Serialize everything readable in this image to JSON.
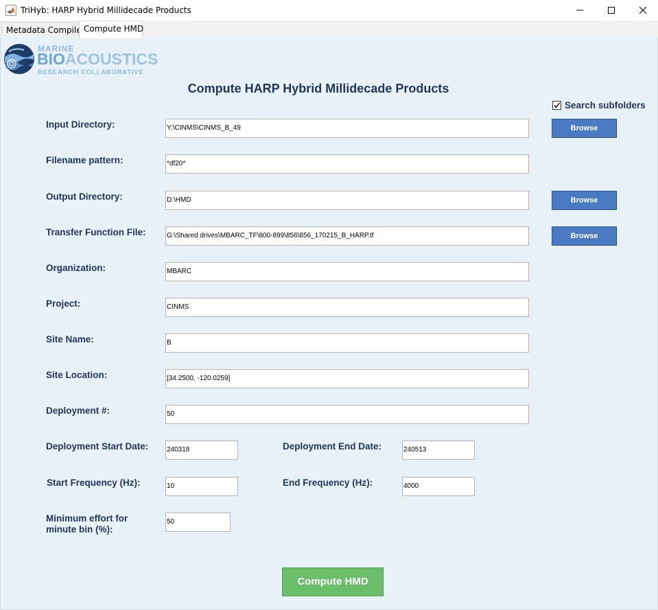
{
  "window": {
    "title": "TriHyb: HARP Hybrid Millidecade Products"
  },
  "tabs": [
    {
      "label": "Metadata Compiler",
      "active": false
    },
    {
      "label": "Compute HMD",
      "active": true
    }
  ],
  "logo": {
    "line1": "MARINE",
    "line2_bio": "BIO",
    "line2_rest": "ACOUSTICS",
    "line3": "RESEARCH COLLABORATIVE"
  },
  "heading": "Compute HARP Hybrid Millidecade Products",
  "search_subfolders": {
    "label": "Search subfolders",
    "checked": true
  },
  "browse_label": "Browse",
  "fields": {
    "input_directory": {
      "label": "Input Directory:",
      "value": "Y:\\CINMS\\CINMS_B_49"
    },
    "filename_pattern": {
      "label": "Filename pattern:",
      "value": "*df20*"
    },
    "output_directory": {
      "label": "Output Directory:",
      "value": "D:\\HMD"
    },
    "transfer_function_file": {
      "label": "Transfer Function File:",
      "value": "G:\\Shared drives\\MBARC_TF\\800-899\\856\\856_170215_B_HARP.tf"
    },
    "organization": {
      "label": "Organization:",
      "value": "MBARC"
    },
    "project": {
      "label": "Project:",
      "value": "CINMS"
    },
    "site_name": {
      "label": "Site Name:",
      "value": "B"
    },
    "site_location": {
      "label": "Site Location:",
      "value": "[34.2500, -120.0259]"
    },
    "deployment_number": {
      "label": "Deployment #:",
      "value": "50"
    },
    "deployment_start_date": {
      "label": "Deployment Start Date:",
      "value": "240318"
    },
    "deployment_end_date": {
      "label": "Deployment End Date:",
      "value": "240513"
    },
    "start_frequency": {
      "label": "Start Frequency (Hz):",
      "value": "10"
    },
    "end_frequency": {
      "label": "End Frequency (Hz):",
      "value": "4000"
    },
    "minimum_effort": {
      "label_line1": "Minimum effort for",
      "label_line2": "minute bin (%):",
      "value": "50"
    }
  },
  "compute_button": "Compute HMD",
  "colors": {
    "label_text": "#1f3560",
    "panel_bg": "#e8f1f8",
    "browse_button": "#4a7bc2",
    "compute_button": "#6bbf6a"
  }
}
